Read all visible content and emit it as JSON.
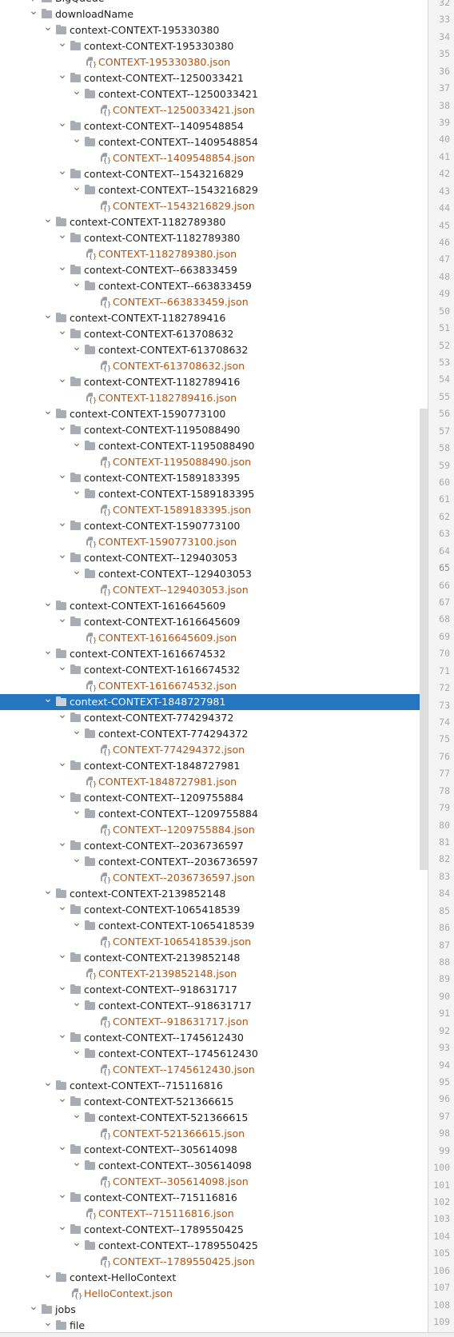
{
  "colors": {
    "selection": "#2675bf",
    "json_text": "#b4520f",
    "scrollbar": "#dedede"
  },
  "tree": [
    {
      "label": "BigQueue",
      "level": 1,
      "type": "folder",
      "expanded": false
    },
    {
      "label": "downloadName",
      "level": 1,
      "type": "folder",
      "expanded": true
    },
    {
      "label": "context-CONTEXT-195330380",
      "level": 2,
      "type": "folder",
      "expanded": true
    },
    {
      "label": "context-CONTEXT-195330380",
      "level": 3,
      "type": "folder",
      "expanded": true
    },
    {
      "label": "CONTEXT-195330380.json",
      "level": 4,
      "type": "json"
    },
    {
      "label": "context-CONTEXT--1250033421",
      "level": 3,
      "type": "folder",
      "expanded": true
    },
    {
      "label": "context-CONTEXT--1250033421",
      "level": 4,
      "type": "folder",
      "expanded": true
    },
    {
      "label": "CONTEXT--1250033421.json",
      "level": 5,
      "type": "json"
    },
    {
      "label": "context-CONTEXT--1409548854",
      "level": 3,
      "type": "folder",
      "expanded": true
    },
    {
      "label": "context-CONTEXT--1409548854",
      "level": 4,
      "type": "folder",
      "expanded": true
    },
    {
      "label": "CONTEXT--1409548854.json",
      "level": 5,
      "type": "json"
    },
    {
      "label": "context-CONTEXT--1543216829",
      "level": 3,
      "type": "folder",
      "expanded": true
    },
    {
      "label": "context-CONTEXT--1543216829",
      "level": 4,
      "type": "folder",
      "expanded": true
    },
    {
      "label": "CONTEXT--1543216829.json",
      "level": 5,
      "type": "json"
    },
    {
      "label": "context-CONTEXT-1182789380",
      "level": 2,
      "type": "folder",
      "expanded": true
    },
    {
      "label": "context-CONTEXT-1182789380",
      "level": 3,
      "type": "folder",
      "expanded": true
    },
    {
      "label": "CONTEXT-1182789380.json",
      "level": 4,
      "type": "json"
    },
    {
      "label": "context-CONTEXT--663833459",
      "level": 3,
      "type": "folder",
      "expanded": true
    },
    {
      "label": "context-CONTEXT--663833459",
      "level": 4,
      "type": "folder",
      "expanded": true
    },
    {
      "label": "CONTEXT--663833459.json",
      "level": 5,
      "type": "json"
    },
    {
      "label": "context-CONTEXT-1182789416",
      "level": 2,
      "type": "folder",
      "expanded": true
    },
    {
      "label": "context-CONTEXT-613708632",
      "level": 3,
      "type": "folder",
      "expanded": true
    },
    {
      "label": "context-CONTEXT-613708632",
      "level": 4,
      "type": "folder",
      "expanded": true
    },
    {
      "label": "CONTEXT-613708632.json",
      "level": 5,
      "type": "json"
    },
    {
      "label": "context-CONTEXT-1182789416",
      "level": 3,
      "type": "folder",
      "expanded": true
    },
    {
      "label": "CONTEXT-1182789416.json",
      "level": 4,
      "type": "json"
    },
    {
      "label": "context-CONTEXT-1590773100",
      "level": 2,
      "type": "folder",
      "expanded": true
    },
    {
      "label": "context-CONTEXT-1195088490",
      "level": 3,
      "type": "folder",
      "expanded": true
    },
    {
      "label": "context-CONTEXT-1195088490",
      "level": 4,
      "type": "folder",
      "expanded": true
    },
    {
      "label": "CONTEXT-1195088490.json",
      "level": 5,
      "type": "json"
    },
    {
      "label": "context-CONTEXT-1589183395",
      "level": 3,
      "type": "folder",
      "expanded": true
    },
    {
      "label": "context-CONTEXT-1589183395",
      "level": 4,
      "type": "folder",
      "expanded": true
    },
    {
      "label": "CONTEXT-1589183395.json",
      "level": 5,
      "type": "json"
    },
    {
      "label": "context-CONTEXT-1590773100",
      "level": 3,
      "type": "folder",
      "expanded": true
    },
    {
      "label": "CONTEXT-1590773100.json",
      "level": 4,
      "type": "json"
    },
    {
      "label": "context-CONTEXT--129403053",
      "level": 3,
      "type": "folder",
      "expanded": true
    },
    {
      "label": "context-CONTEXT--129403053",
      "level": 4,
      "type": "folder",
      "expanded": true
    },
    {
      "label": "CONTEXT--129403053.json",
      "level": 5,
      "type": "json"
    },
    {
      "label": "context-CONTEXT-1616645609",
      "level": 2,
      "type": "folder",
      "expanded": true
    },
    {
      "label": "context-CONTEXT-1616645609",
      "level": 3,
      "type": "folder",
      "expanded": true
    },
    {
      "label": "CONTEXT-1616645609.json",
      "level": 4,
      "type": "json"
    },
    {
      "label": "context-CONTEXT-1616674532",
      "level": 2,
      "type": "folder",
      "expanded": true
    },
    {
      "label": "context-CONTEXT-1616674532",
      "level": 3,
      "type": "folder",
      "expanded": true
    },
    {
      "label": "CONTEXT-1616674532.json",
      "level": 4,
      "type": "json"
    },
    {
      "label": "context-CONTEXT-1848727981",
      "level": 2,
      "type": "folder",
      "expanded": true,
      "selected": true
    },
    {
      "label": "context-CONTEXT-774294372",
      "level": 3,
      "type": "folder",
      "expanded": true
    },
    {
      "label": "context-CONTEXT-774294372",
      "level": 4,
      "type": "folder",
      "expanded": true
    },
    {
      "label": "CONTEXT-774294372.json",
      "level": 5,
      "type": "json"
    },
    {
      "label": "context-CONTEXT-1848727981",
      "level": 3,
      "type": "folder",
      "expanded": true
    },
    {
      "label": "CONTEXT-1848727981.json",
      "level": 4,
      "type": "json"
    },
    {
      "label": "context-CONTEXT--1209755884",
      "level": 3,
      "type": "folder",
      "expanded": true
    },
    {
      "label": "context-CONTEXT--1209755884",
      "level": 4,
      "type": "folder",
      "expanded": true
    },
    {
      "label": "CONTEXT--1209755884.json",
      "level": 5,
      "type": "json"
    },
    {
      "label": "context-CONTEXT--2036736597",
      "level": 3,
      "type": "folder",
      "expanded": true
    },
    {
      "label": "context-CONTEXT--2036736597",
      "level": 4,
      "type": "folder",
      "expanded": true
    },
    {
      "label": "CONTEXT--2036736597.json",
      "level": 5,
      "type": "json"
    },
    {
      "label": "context-CONTEXT-2139852148",
      "level": 2,
      "type": "folder",
      "expanded": true
    },
    {
      "label": "context-CONTEXT-1065418539",
      "level": 3,
      "type": "folder",
      "expanded": true
    },
    {
      "label": "context-CONTEXT-1065418539",
      "level": 4,
      "type": "folder",
      "expanded": true
    },
    {
      "label": "CONTEXT-1065418539.json",
      "level": 5,
      "type": "json"
    },
    {
      "label": "context-CONTEXT-2139852148",
      "level": 3,
      "type": "folder",
      "expanded": true
    },
    {
      "label": "CONTEXT-2139852148.json",
      "level": 4,
      "type": "json"
    },
    {
      "label": "context-CONTEXT--918631717",
      "level": 3,
      "type": "folder",
      "expanded": true
    },
    {
      "label": "context-CONTEXT--918631717",
      "level": 4,
      "type": "folder",
      "expanded": true
    },
    {
      "label": "CONTEXT--918631717.json",
      "level": 5,
      "type": "json"
    },
    {
      "label": "context-CONTEXT--1745612430",
      "level": 3,
      "type": "folder",
      "expanded": true
    },
    {
      "label": "context-CONTEXT--1745612430",
      "level": 4,
      "type": "folder",
      "expanded": true
    },
    {
      "label": "CONTEXT--1745612430.json",
      "level": 5,
      "type": "json"
    },
    {
      "label": "context-CONTEXT--715116816",
      "level": 2,
      "type": "folder",
      "expanded": true
    },
    {
      "label": "context-CONTEXT-521366615",
      "level": 3,
      "type": "folder",
      "expanded": true
    },
    {
      "label": "context-CONTEXT-521366615",
      "level": 4,
      "type": "folder",
      "expanded": true
    },
    {
      "label": "CONTEXT-521366615.json",
      "level": 5,
      "type": "json"
    },
    {
      "label": "context-CONTEXT--305614098",
      "level": 3,
      "type": "folder",
      "expanded": true
    },
    {
      "label": "context-CONTEXT--305614098",
      "level": 4,
      "type": "folder",
      "expanded": true
    },
    {
      "label": "CONTEXT--305614098.json",
      "level": 5,
      "type": "json"
    },
    {
      "label": "context-CONTEXT--715116816",
      "level": 3,
      "type": "folder",
      "expanded": true
    },
    {
      "label": "CONTEXT--715116816.json",
      "level": 4,
      "type": "json"
    },
    {
      "label": "context-CONTEXT--1789550425",
      "level": 3,
      "type": "folder",
      "expanded": true
    },
    {
      "label": "context-CONTEXT--1789550425",
      "level": 4,
      "type": "folder",
      "expanded": true
    },
    {
      "label": "CONTEXT--1789550425.json",
      "level": 5,
      "type": "json"
    },
    {
      "label": "context-HelloContext",
      "level": 2,
      "type": "folder",
      "expanded": true
    },
    {
      "label": "HelloContext.json",
      "level": 3,
      "type": "json"
    },
    {
      "label": "jobs",
      "level": 1,
      "type": "folder",
      "expanded": true
    },
    {
      "label": "file",
      "level": 2,
      "type": "folder",
      "expanded": true
    }
  ],
  "line_numbers": {
    "first": 32,
    "last": 109,
    "current": 65
  }
}
